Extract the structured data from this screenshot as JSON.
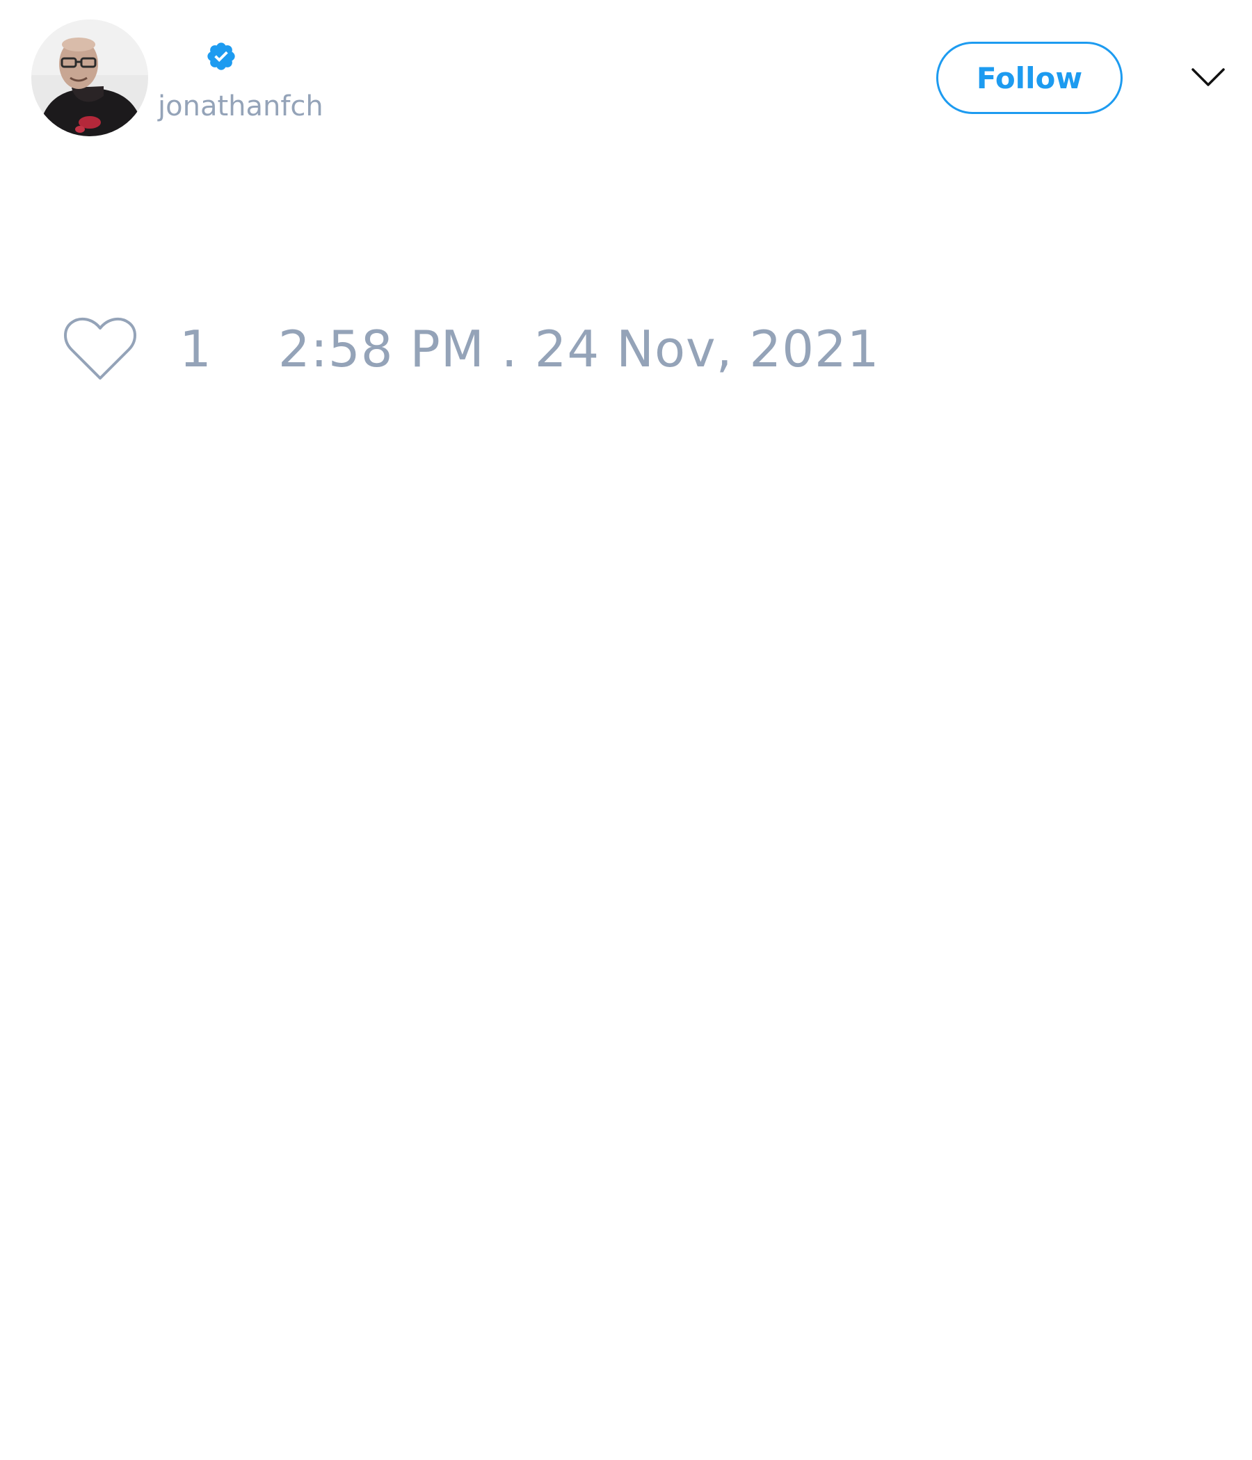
{
  "author": {
    "avatar_icon": "user-avatar-photo",
    "verified_icon": "verified-badge-icon",
    "handle": "jonathanfch"
  },
  "actions": {
    "follow_label": "Follow",
    "menu_icon": "chevron-down-icon"
  },
  "tweet": {
    "like_icon": "heart-icon",
    "like_count": "1",
    "timestamp": "2:58 PM . 24 Nov, 2021"
  },
  "colors": {
    "accent": "#1d9bf0",
    "muted_text": "#94a3b8",
    "background": "#ffffff"
  }
}
